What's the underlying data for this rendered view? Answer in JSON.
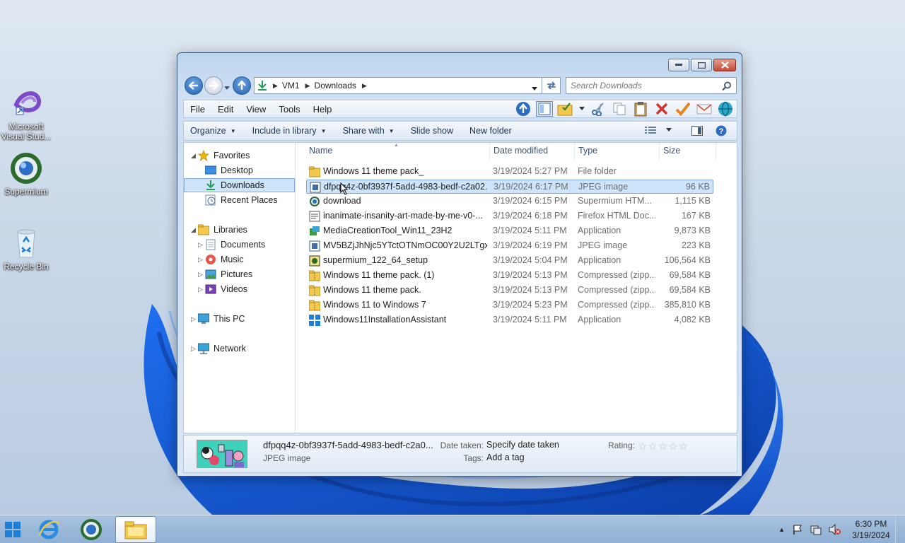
{
  "desktop": {
    "icons": [
      {
        "label": "Microsoft Visual Stud...",
        "icon": "visual-studio-icon"
      },
      {
        "label": "Supermium",
        "icon": "supermium-icon"
      },
      {
        "label": "Recycle Bin",
        "icon": "recycle-bin-icon"
      }
    ]
  },
  "window": {
    "breadcrumb": [
      "VM1",
      "Downloads"
    ],
    "search_placeholder": "Search Downloads",
    "menu": [
      "File",
      "Edit",
      "View",
      "Tools",
      "Help"
    ],
    "commands": [
      {
        "label": "Organize",
        "dropdown": true
      },
      {
        "label": "Include in library",
        "dropdown": true
      },
      {
        "label": "Share with",
        "dropdown": true
      },
      {
        "label": "Slide show",
        "dropdown": false
      },
      {
        "label": "New folder",
        "dropdown": false
      }
    ]
  },
  "navpane": {
    "favorites": "Favorites",
    "fav_items": [
      "Desktop",
      "Downloads",
      "Recent Places"
    ],
    "libraries": "Libraries",
    "lib_items": [
      "Documents",
      "Music",
      "Pictures",
      "Videos"
    ],
    "this_pc": "This PC",
    "network": "Network"
  },
  "columns": {
    "name": "Name",
    "date": "Date modified",
    "type": "Type",
    "size": "Size"
  },
  "files": [
    {
      "name": "Windows 11 theme pack_",
      "date": "3/19/2024 5:27 PM",
      "type": "File folder",
      "size": "",
      "icon": "folder-icon"
    },
    {
      "name": "dfpqq4z-0bf3937f-5add-4983-bedf-c2a02...",
      "date": "3/19/2024 6:17 PM",
      "type": "JPEG image",
      "size": "96 KB",
      "icon": "image-file-icon"
    },
    {
      "name": "download",
      "date": "3/19/2024 6:15 PM",
      "type": "Supermium HTM...",
      "size": "1,115 KB",
      "icon": "supermium-html-icon"
    },
    {
      "name": "inanimate-insanity-art-made-by-me-v0-...",
      "date": "3/19/2024 6:18 PM",
      "type": "Firefox HTML Doc...",
      "size": "167 KB",
      "icon": "html-doc-icon"
    },
    {
      "name": "MediaCreationTool_Win11_23H2",
      "date": "3/19/2024 5:11 PM",
      "type": "Application",
      "size": "9,873 KB",
      "icon": "media-tool-icon"
    },
    {
      "name": "MV5BZjJhNjc5YTctOTNmOC00Y2U2LTgx...",
      "date": "3/19/2024 6:19 PM",
      "type": "JPEG image",
      "size": "223 KB",
      "icon": "image-file-icon"
    },
    {
      "name": "supermium_122_64_setup",
      "date": "3/19/2024 5:04 PM",
      "type": "Application",
      "size": "106,564 KB",
      "icon": "setup-icon"
    },
    {
      "name": "Windows 11 theme pack. (1)",
      "date": "3/19/2024 5:13 PM",
      "type": "Compressed (zipp...",
      "size": "69,584 KB",
      "icon": "zip-folder-icon"
    },
    {
      "name": "Windows 11 theme pack.",
      "date": "3/19/2024 5:13 PM",
      "type": "Compressed (zipp...",
      "size": "69,584 KB",
      "icon": "zip-folder-icon"
    },
    {
      "name": "Windows 11 to Windows 7",
      "date": "3/19/2024 5:23 PM",
      "type": "Compressed (zipp...",
      "size": "385,810 KB",
      "icon": "zip-folder-icon"
    },
    {
      "name": "Windows11InstallationAssistant",
      "date": "3/19/2024 5:11 PM",
      "type": "Application",
      "size": "4,082 KB",
      "icon": "windows-logo-icon"
    }
  ],
  "selected_index": 1,
  "details": {
    "name": "dfpqq4z-0bf3937f-5add-4983-bedf-c2a0...",
    "type": "JPEG image",
    "date_taken_label": "Date taken:",
    "date_taken_value": "Specify date taken",
    "tags_label": "Tags:",
    "tags_value": "Add a tag",
    "rating_label": "Rating:",
    "rating_stars": "☆☆☆☆☆"
  },
  "taskbar": {
    "time": "6:30 PM",
    "date": "3/19/2024"
  },
  "colors": {
    "selection": "#cde4fb",
    "accent": "#2262b3"
  }
}
